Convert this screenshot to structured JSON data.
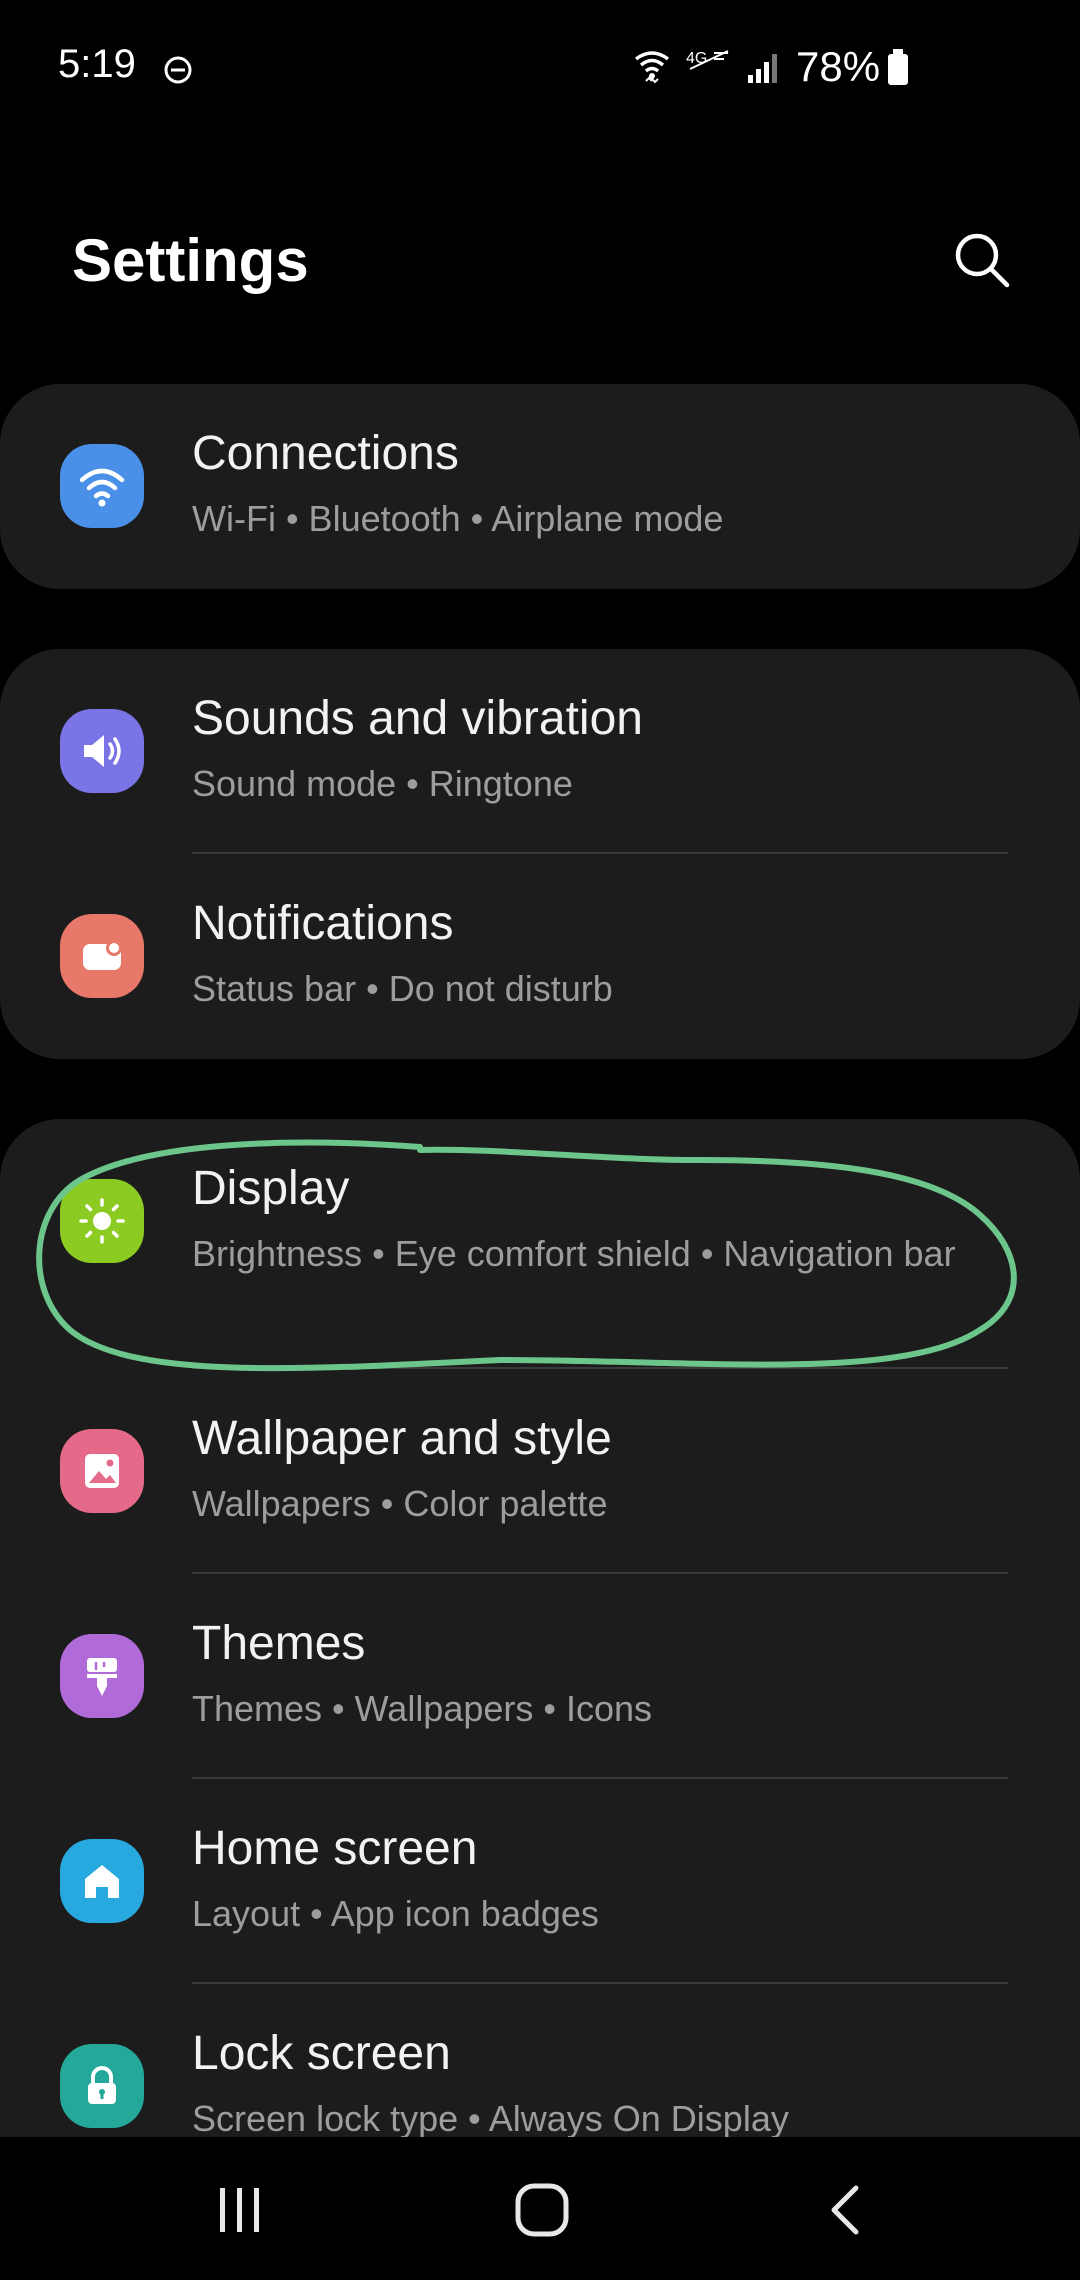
{
  "status_bar": {
    "time": "5:19",
    "battery_percent": "78%",
    "icons": [
      "dnd-icon",
      "wifi-icon",
      "lte-icon",
      "signal-icon",
      "battery-icon"
    ]
  },
  "header": {
    "title": "Settings",
    "search_icon": "search-icon"
  },
  "groups": [
    {
      "items": [
        {
          "title": "Connections",
          "subtitle": "Wi-Fi  •  Bluetooth  •  Airplane mode",
          "icon": "wifi-icon",
          "icon_color": "#4a90e8"
        }
      ]
    },
    {
      "items": [
        {
          "title": "Sounds and vibration",
          "subtitle": "Sound mode  •  Ringtone",
          "icon": "speaker-icon",
          "icon_color": "#7b74e6"
        },
        {
          "title": "Notifications",
          "subtitle": "Status bar  •  Do not disturb",
          "icon": "notification-icon",
          "icon_color": "#e8786a"
        }
      ]
    },
    {
      "items": [
        {
          "title": "Display",
          "subtitle": "Brightness  •  Eye comfort shield  •  Navigation bar",
          "icon": "sun-icon",
          "icon_color": "#8ccb22"
        },
        {
          "title": "Wallpaper and style",
          "subtitle": "Wallpapers  •  Color palette",
          "icon": "image-icon",
          "icon_color": "#e56a8a"
        },
        {
          "title": "Themes",
          "subtitle": "Themes  •  Wallpapers  •  Icons",
          "icon": "brush-icon",
          "icon_color": "#b16bd9"
        },
        {
          "title": "Home screen",
          "subtitle": "Layout  •  App icon badges",
          "icon": "home-icon",
          "icon_color": "#27a9e0"
        },
        {
          "title": "Lock screen",
          "subtitle": "Screen lock type  •  Always On Display",
          "icon": "lock-icon",
          "icon_color": "#23a89a"
        }
      ]
    }
  ],
  "nav": {
    "recents": "recents-icon",
    "home": "home-nav-icon",
    "back": "back-icon"
  },
  "annotation": {
    "color": "#6cc58a",
    "target": "Display"
  }
}
